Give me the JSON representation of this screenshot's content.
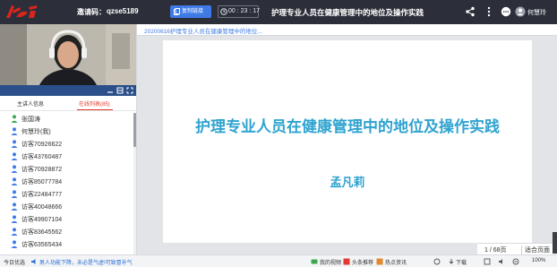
{
  "topbar": {
    "invite_label": "邀请码：",
    "invite_code": "qzse5189",
    "copy_label": "复制链接",
    "timer": "00 : 23 : 17",
    "title": "护理专业人员在健康管理中的地位及操作实践",
    "user_name": "何慧玲"
  },
  "left": {
    "tabs": [
      "主讲人信息",
      "在线列表(85)"
    ],
    "participants": [
      "张国涛",
      "何慧玲(我)",
      "访客70926622",
      "访客43760487",
      "访客70928872",
      "访客85077784",
      "访客22484777",
      "访客40048666",
      "访客49907104",
      "访客83645562",
      "访客63565434"
    ]
  },
  "main": {
    "doc_tab": "20200616护理专业人员在健康管理中的地位...",
    "slide_title": "护理专业人员在健康管理中的地位及操作实践",
    "slide_author": "孟凡莉",
    "page": "1  /  68页",
    "fit": "适合页面 ▲"
  },
  "status": {
    "item1": "今日优选",
    "news": "男人功能下降，未必是气虚!可致冒补气",
    "item2": "我的视频",
    "item3": "头条推荐",
    "item4": "热点资讯",
    "item5": "下载",
    "item6": "100%"
  },
  "colors": {
    "accent": "#3f7be6",
    "slide_text": "#2fa3d0",
    "active_tab": "#e23a2e",
    "topbar_bg": "#2c2f3a",
    "user_icon": "#3f7be6",
    "host_icon": "#3aa84f"
  }
}
